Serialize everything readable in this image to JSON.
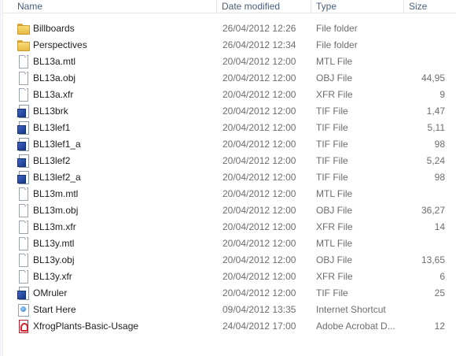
{
  "columns": {
    "name": "Name",
    "date_modified": "Date modified",
    "type": "Type",
    "size": "Size"
  },
  "files": [
    {
      "name": "Billboards",
      "date": "26/04/2012 12:26",
      "type": "File folder",
      "size": "",
      "icon": "folder-icon"
    },
    {
      "name": "Perspectives",
      "date": "26/04/2012 12:34",
      "type": "File folder",
      "size": "",
      "icon": "folder-icon"
    },
    {
      "name": "BL13a.mtl",
      "date": "20/04/2012 12:00",
      "type": "MTL File",
      "size": "",
      "icon": "document-icon"
    },
    {
      "name": "BL13a.obj",
      "date": "20/04/2012 12:00",
      "type": "OBJ File",
      "size": "44,95",
      "icon": "document-icon"
    },
    {
      "name": "BL13a.xfr",
      "date": "20/04/2012 12:00",
      "type": "XFR File",
      "size": "9",
      "icon": "document-icon"
    },
    {
      "name": "BL13brk",
      "date": "20/04/2012 12:00",
      "type": "TIF File",
      "size": "1,47",
      "icon": "tif-image-icon"
    },
    {
      "name": "BL13lef1",
      "date": "20/04/2012 12:00",
      "type": "TIF File",
      "size": "5,11",
      "icon": "tif-image-icon"
    },
    {
      "name": "BL13lef1_a",
      "date": "20/04/2012 12:00",
      "type": "TIF File",
      "size": "98",
      "icon": "tif-image-icon"
    },
    {
      "name": "BL13lef2",
      "date": "20/04/2012 12:00",
      "type": "TIF File",
      "size": "5,24",
      "icon": "tif-image-icon"
    },
    {
      "name": "BL13lef2_a",
      "date": "20/04/2012 12:00",
      "type": "TIF File",
      "size": "98",
      "icon": "tif-image-icon"
    },
    {
      "name": "BL13m.mtl",
      "date": "20/04/2012 12:00",
      "type": "MTL File",
      "size": "",
      "icon": "document-icon"
    },
    {
      "name": "BL13m.obj",
      "date": "20/04/2012 12:00",
      "type": "OBJ File",
      "size": "36,27",
      "icon": "document-icon"
    },
    {
      "name": "BL13m.xfr",
      "date": "20/04/2012 12:00",
      "type": "XFR File",
      "size": "14",
      "icon": "document-icon"
    },
    {
      "name": "BL13y.mtl",
      "date": "20/04/2012 12:00",
      "type": "MTL File",
      "size": "",
      "icon": "document-icon"
    },
    {
      "name": "BL13y.obj",
      "date": "20/04/2012 12:00",
      "type": "OBJ File",
      "size": "13,65",
      "icon": "document-icon"
    },
    {
      "name": "BL13y.xfr",
      "date": "20/04/2012 12:00",
      "type": "XFR File",
      "size": "6",
      "icon": "document-icon"
    },
    {
      "name": "OMruler",
      "date": "20/04/2012 12:00",
      "type": "TIF File",
      "size": "25",
      "icon": "tif-image-icon"
    },
    {
      "name": "Start Here",
      "date": "09/04/2012 13:35",
      "type": "Internet Shortcut",
      "size": "",
      "icon": "internet-shortcut-icon"
    },
    {
      "name": "XfrogPlants-Basic-Usage",
      "date": "24/04/2012 17:00",
      "type": "Adobe Acrobat D...",
      "size": "12",
      "icon": "pdf-icon"
    }
  ]
}
